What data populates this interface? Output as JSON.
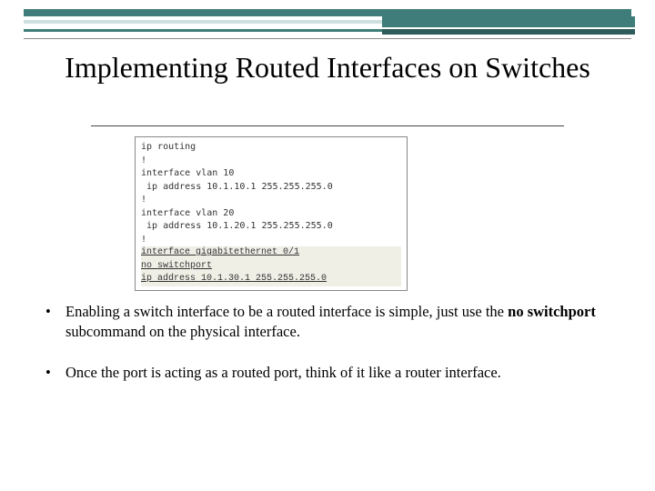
{
  "title": "Implementing Routed Interfaces on Switches",
  "code": {
    "lines_plain": [
      "ip routing",
      "!",
      "interface vlan 10",
      " ip address 10.1.10.1 255.255.255.0",
      "!",
      "interface vlan 20",
      " ip address 10.1.20.1 255.255.255.0",
      "!"
    ],
    "hl1": "interface gigabitethernet 0/1",
    "hl2": " no switchport",
    "hl3": " ip address 10.1.30.1 255.255.255.0"
  },
  "bullets": {
    "b1_pre": "Enabling a switch interface to be a routed interface is simple, just use the ",
    "b1_bold": "no switchport",
    "b1_post": " subcommand on the physical interface.",
    "b2": "Once the port is acting as a routed port, think of it like a router interface."
  }
}
